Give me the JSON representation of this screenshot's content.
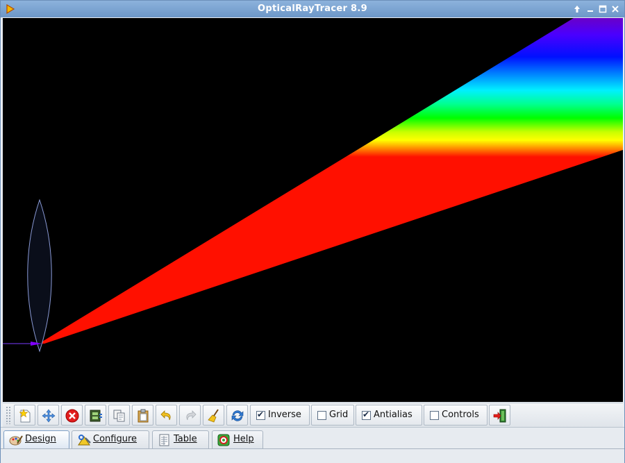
{
  "window": {
    "title": "OpticalRayTracer 8.9"
  },
  "canvas": {
    "background": "#000000",
    "lens_outline_color": "#7f8fcf",
    "spectrum_colors": [
      "#6000c0",
      "#5000ff",
      "#0000ff",
      "#0080ff",
      "#00ffff",
      "#00ff80",
      "#00ff00",
      "#c0ff00",
      "#ffff00",
      "#ff8000",
      "#ff0000"
    ]
  },
  "toolbar": {
    "buttons": [
      {
        "name": "new-icon"
      },
      {
        "name": "move-icon"
      },
      {
        "name": "delete-icon"
      },
      {
        "name": "film-icon"
      },
      {
        "name": "copy-icon"
      },
      {
        "name": "paste-icon"
      },
      {
        "name": "undo-icon"
      },
      {
        "name": "redo-icon"
      },
      {
        "name": "broom-icon"
      },
      {
        "name": "refresh-icon"
      }
    ],
    "checks": {
      "inverse": {
        "label": "Inverse",
        "checked": true
      },
      "grid": {
        "label": "Grid",
        "checked": false
      },
      "antialias": {
        "label": "Antialias",
        "checked": true
      },
      "controls": {
        "label": "Controls",
        "checked": false
      }
    },
    "exit_icon": "exit-icon"
  },
  "tabs": [
    {
      "label": "Design",
      "icon": "palette-icon",
      "active": true
    },
    {
      "label": "Configure",
      "icon": "tools-icon",
      "active": false
    },
    {
      "label": "Table",
      "icon": "table-icon",
      "active": false
    },
    {
      "label": "Help",
      "icon": "help-icon",
      "active": false
    }
  ]
}
